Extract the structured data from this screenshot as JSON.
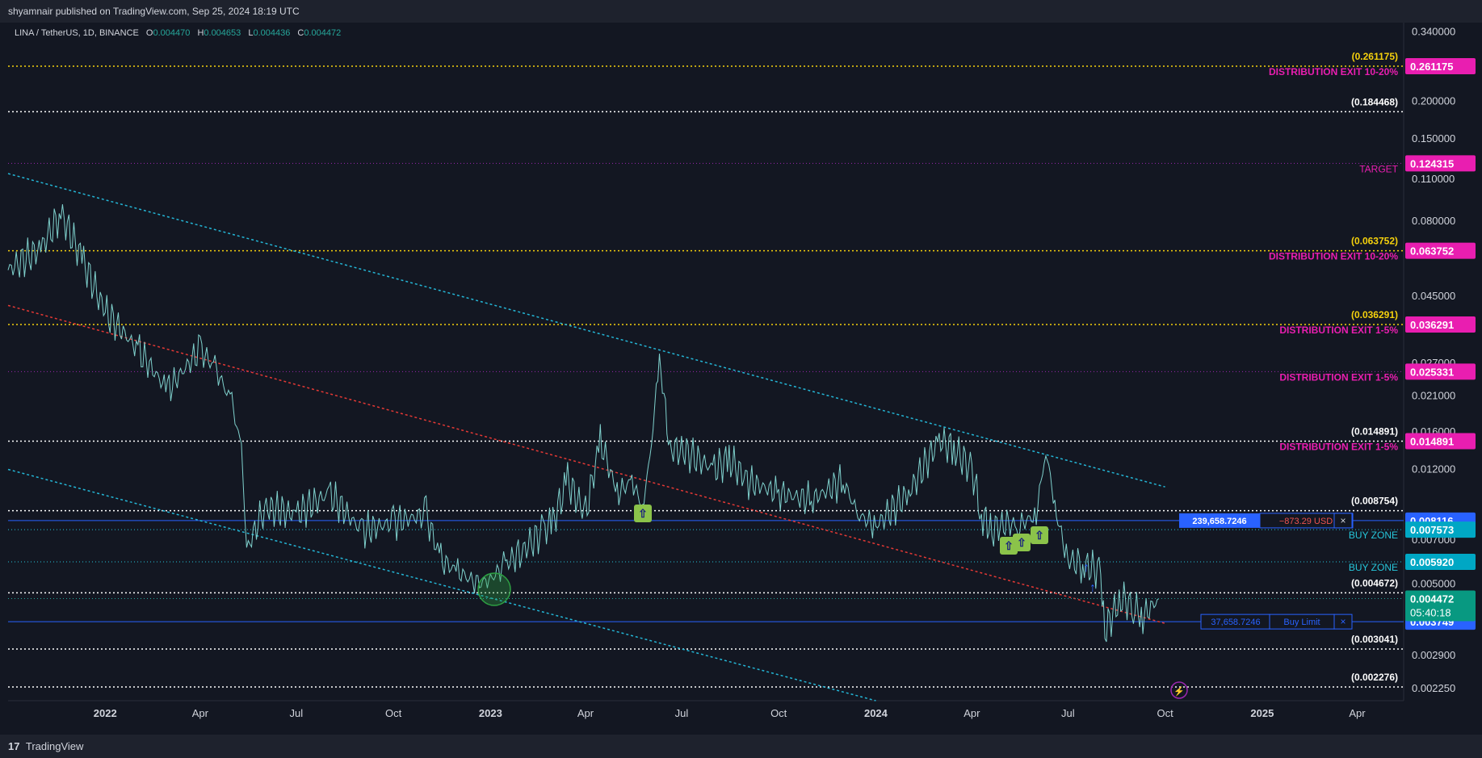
{
  "header": {
    "published": "shyamnair published on TradingView.com, Sep 25, 2024 18:19 UTC"
  },
  "legend": {
    "symbol": "LINA / TetherUS, 1D, BINANCE",
    "open_label": "O",
    "open": "0.004470",
    "high_label": "H",
    "high": "0.004653",
    "low_label": "L",
    "low": "0.004436",
    "close_label": "C",
    "close": "0.004472"
  },
  "footer": {
    "brand": "TradingView"
  },
  "colors": {
    "background": "#131722",
    "candle": "#7fd1cd",
    "cyan_line": "#24b6d6",
    "red_line": "#e53935",
    "magenta": "#e91eb0",
    "yellow": "#f5d10c",
    "blue_label": "#2962ff",
    "teal_label": "#089981"
  },
  "chart_data": {
    "type": "line",
    "title": "",
    "xlabel": "",
    "ylabel": "",
    "scale": "log",
    "ylim": [
      0.00205,
      0.36
    ],
    "x_ticks": [
      "2022",
      "Apr",
      "Jul",
      "Oct",
      "2023",
      "Apr",
      "Jul",
      "Oct",
      "2024",
      "Apr",
      "Jul",
      "Oct",
      "2025",
      "Apr"
    ],
    "y_ticks": [
      "0.340000",
      "0.200000",
      "0.150000",
      "0.110000",
      "0.080000",
      "0.045000",
      "0.027000",
      "0.021000",
      "0.016000",
      "0.012000",
      "0.007000",
      "0.005000",
      "0.002900",
      "0.002250"
    ],
    "series": [
      {
        "x": [
          "2021-10-01",
          "2021-11-01",
          "2021-11-20",
          "2021-12-10",
          "2022-01-01",
          "2022-02-01",
          "2022-03-01",
          "2022-04-01",
          "2022-04-15",
          "2022-05-01",
          "2022-05-10",
          "2022-05-15",
          "2022-06-01",
          "2022-07-01",
          "2022-08-01",
          "2022-09-01",
          "2022-10-01",
          "2022-11-01",
          "2022-11-15",
          "2022-12-01",
          "2022-12-20",
          "2023-01-01",
          "2023-01-15",
          "2023-02-01",
          "2023-02-20",
          "2023-03-01",
          "2023-03-15",
          "2023-04-01",
          "2023-04-15",
          "2023-05-01",
          "2023-05-15",
          "2023-05-25",
          "2023-06-01",
          "2023-06-10",
          "2023-06-20",
          "2023-07-01",
          "2023-08-01",
          "2023-08-15",
          "2023-09-01",
          "2023-10-01",
          "2023-11-01",
          "2023-12-01",
          "2023-12-15",
          "2024-01-01",
          "2024-02-01",
          "2024-03-01",
          "2024-03-15",
          "2024-04-01",
          "2024-04-10",
          "2024-04-20",
          "2024-05-01",
          "2024-05-15",
          "2024-06-01",
          "2024-06-10",
          "2024-06-20",
          "2024-07-01",
          "2024-07-15",
          "2024-08-01",
          "2024-08-05",
          "2024-08-20",
          "2024-09-01",
          "2024-09-10",
          "2024-09-25"
        ],
        "y": [
          0.055,
          0.065,
          0.085,
          0.06,
          0.04,
          0.03,
          0.022,
          0.03,
          0.026,
          0.02,
          0.014,
          0.0065,
          0.009,
          0.0085,
          0.01,
          0.0075,
          0.008,
          0.0085,
          0.006,
          0.0055,
          0.005,
          0.0052,
          0.0058,
          0.0065,
          0.0075,
          0.008,
          0.011,
          0.0085,
          0.015,
          0.01,
          0.011,
          0.009,
          0.013,
          0.028,
          0.014,
          0.014,
          0.012,
          0.013,
          0.011,
          0.01,
          0.0095,
          0.011,
          0.0085,
          0.0078,
          0.01,
          0.015,
          0.014,
          0.012,
          0.0085,
          0.0075,
          0.008,
          0.0078,
          0.0085,
          0.014,
          0.0085,
          0.006,
          0.0058,
          0.0055,
          0.0035,
          0.0045,
          0.0042,
          0.0039,
          0.00447
        ]
      }
    ],
    "horizontal_levels": [
      {
        "price": 0.261175,
        "label": "DISTRIBUTION EXIT 10-20%",
        "value_label": "(0.261175)",
        "axis_label": "0.261175",
        "style": "yellow-dotted"
      },
      {
        "price": 0.184468,
        "value_label": "(0.184468)",
        "style": "white-dotted"
      },
      {
        "price": 0.124315,
        "label": "TARGET",
        "axis_label": "0.124315",
        "style": "magenta-dotted"
      },
      {
        "price": 0.063752,
        "label": "DISTRIBUTION EXIT 10-20%",
        "value_label": "(0.063752)",
        "axis_label": "0.063752",
        "style": "yellow-dotted"
      },
      {
        "price": 0.036291,
        "label": "DISTRIBUTION EXIT 1-5%",
        "value_label": "(0.036291)",
        "axis_label": "0.036291",
        "style": "yellow-dotted"
      },
      {
        "price": 0.025331,
        "label": "DISTRIBUTION EXIT 1-5%",
        "axis_label": "0.025331",
        "style": "magenta-dotted"
      },
      {
        "price": 0.014891,
        "label": "DISTRIBUTION EXIT 1-5%",
        "value_label": "(0.014891)",
        "axis_label": "0.014891",
        "style": "white-dotted"
      },
      {
        "price": 0.008754,
        "value_label": "(0.008754)",
        "style": "white-dotted"
      },
      {
        "price": 0.008116,
        "axis_label": "0.008116",
        "style": "blue-solid"
      },
      {
        "price": 0.007573,
        "label": "BUY ZONE",
        "axis_label": "0.007573",
        "style": "teal-dotted"
      },
      {
        "price": 0.00592,
        "label": "BUY ZONE",
        "axis_label": "0.005920",
        "style": "teal-dotted"
      },
      {
        "price": 0.004672,
        "value_label": "(0.004672)",
        "style": "white-dotted"
      },
      {
        "price": 0.003749,
        "axis_label": "0.003749",
        "style": "blue-solid"
      },
      {
        "price": 0.003041,
        "value_label": "(0.003041)",
        "style": "white-dotted"
      },
      {
        "price": 0.002276,
        "value_label": "(0.002276)",
        "style": "white-dotted"
      }
    ],
    "current_price": {
      "value": "0.004472",
      "countdown": "05:40:18"
    },
    "positions": [
      {
        "qty": "239,658.7246",
        "pnl": "−873.29 USD",
        "close": "×"
      },
      {
        "qty": "37,658.7246",
        "type": "Buy Limit",
        "close": "×"
      }
    ],
    "channel": {
      "upper": {
        "from": [
          "2021-10-01",
          0.115
        ],
        "to": [
          "2024-10-01",
          0.0105
        ]
      },
      "middle": {
        "from": [
          "2021-10-01",
          0.042
        ],
        "to": [
          "2024-10-01",
          0.0037
        ]
      },
      "lower": {
        "from": [
          "2021-10-01",
          0.012
        ],
        "to": [
          "2024-01-01",
          0.00205
        ]
      }
    }
  }
}
